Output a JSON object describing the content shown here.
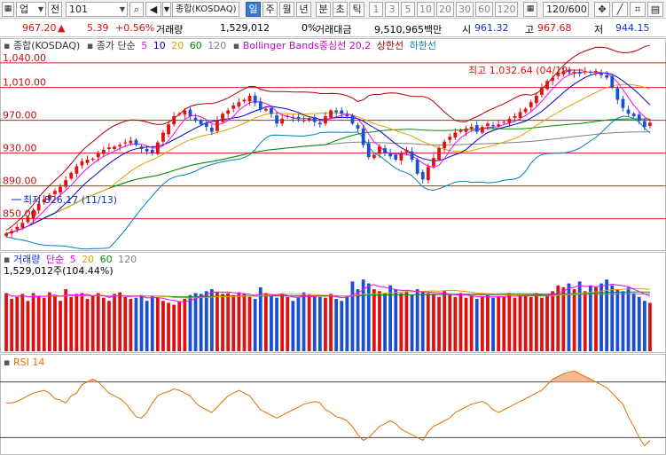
{
  "toolbar": {
    "market": "업",
    "market_btn": "전",
    "code": "101",
    "index_name": "종합(KOSDAQ)",
    "periods": [
      "일",
      "주",
      "월",
      "년",
      "분",
      "초",
      "틱"
    ],
    "selected_period": "일",
    "minute_steps": [
      "1",
      "3",
      "5",
      "10",
      "20",
      "30",
      "60",
      "120"
    ],
    "count_display": "120/600"
  },
  "quote": {
    "price": "967.20",
    "change_symbol": "▲",
    "change": "5.39",
    "change_pct": "+0.56%",
    "volume_label": "거래량",
    "volume": "1,529,012",
    "volume_ratio": "0%",
    "amount_label": "거래대금",
    "amount": "9,510,965백만",
    "open_label": "시",
    "open": "961.32",
    "high_label": "고",
    "high": "967.68",
    "low_label": "저",
    "low": "944.15"
  },
  "price_pane": {
    "legend_name": "종합(KOSDAQ)",
    "ma_label": "종가 단순",
    "ma_periods": [
      "5",
      "10",
      "20",
      "60",
      "120"
    ],
    "bollinger_label": "Bollinger Bands중심선 20,2",
    "upper_label": "상한선",
    "lower_label": "하한선",
    "y_ticks": [
      "1,040.00",
      "1,010.00",
      "970.00",
      "930.00",
      "890.00",
      "850.00"
    ],
    "high_annotation": "최고 1,032.64 (04/19)",
    "low_annotation": "최저 826.17 (11/13)"
  },
  "volume_pane": {
    "label": "거래량",
    "ma_label": "단순",
    "ma_periods": [
      "5",
      "20",
      "60",
      "120"
    ],
    "current": "1,529,012주(104.44%)"
  },
  "rsi_pane": {
    "label": "RSI 14"
  },
  "colors": {
    "up": "#e01010",
    "down": "#1a4fd0",
    "ma5": "#ff00ff",
    "ma10": "#0000cc",
    "ma20": "#e0a000",
    "ma60": "#009000",
    "ma120": "#808080",
    "bollinger_upper": "#b00000",
    "bollinger_mid": "#e07000",
    "bollinger_lower": "#0080c0",
    "rsi_line": "#e07000",
    "rsi_fill": "#f5b890"
  },
  "chart_data": {
    "type": "candlestick",
    "price_range": [
      815,
      1055
    ],
    "closes": [
      832,
      835,
      840,
      845,
      852,
      860,
      868,
      874,
      879,
      884,
      889,
      897,
      906,
      914,
      920,
      922,
      923,
      930,
      934,
      937,
      938,
      940,
      943,
      945,
      940,
      935,
      932,
      930,
      943,
      955,
      965,
      975,
      978,
      982,
      975,
      970,
      965,
      962,
      956,
      970,
      978,
      982,
      988,
      992,
      995,
      1000,
      991,
      983,
      984,
      978,
      966,
      972,
      975,
      973,
      972,
      970,
      972,
      968,
      965,
      975,
      982,
      980,
      978,
      975,
      966,
      960,
      940,
      925,
      928,
      938,
      930,
      926,
      922,
      930,
      934,
      922,
      905,
      898,
      913,
      924,
      936,
      944,
      950,
      955,
      958,
      960,
      962,
      956,
      962,
      966,
      963,
      965,
      968,
      972,
      975,
      980,
      984,
      992,
      1000,
      1010,
      1018,
      1022,
      1027,
      1030,
      1029,
      1029,
      1027,
      1030,
      1028,
      1030,
      1025,
      1022,
      1010,
      995,
      985,
      978,
      975,
      970,
      962,
      967
    ],
    "volume_max": 1900000,
    "volumes": [
      1500000,
      1350000,
      1400000,
      1480000,
      1300000,
      1500000,
      1420000,
      1380000,
      1520000,
      1450000,
      1300000,
      1600000,
      1400000,
      1480000,
      1500000,
      1350000,
      1420000,
      1500000,
      1380000,
      1300000,
      1480000,
      1520000,
      1400000,
      1350000,
      1380000,
      1450000,
      1300000,
      1420000,
      1380000,
      1300000,
      1250000,
      1200000,
      1280000,
      1350000,
      1450000,
      1500000,
      1480000,
      1550000,
      1600000,
      1520000,
      1480000,
      1500000,
      1450000,
      1520000,
      1480000,
      1400000,
      1350000,
      1650000,
      1500000,
      1420000,
      1380000,
      1480000,
      1400000,
      1300000,
      1380000,
      1520000,
      1450000,
      1420000,
      1400000,
      1380000,
      1480000,
      1350000,
      1300000,
      1420000,
      1800000,
      1600000,
      1850000,
      1750000,
      1600000,
      1550000,
      1500000,
      1700000,
      1600000,
      1500000,
      1550000,
      1450000,
      1600000,
      1550000,
      1500000,
      1480000,
      1400000,
      1550000,
      1450000,
      1400000,
      1500000,
      1380000,
      1420000,
      1350000,
      1400000,
      1450000,
      1380000,
      1420000,
      1400000,
      1500000,
      1380000,
      1450000,
      1420000,
      1400000,
      1500000,
      1380000,
      1450000,
      1550000,
      1700000,
      1650000,
      1750000,
      1600000,
      1800000,
      1550000,
      1700000,
      1650000,
      1750000,
      1850000,
      1700000,
      1600000,
      1550000,
      1650000,
      1500000,
      1400000,
      1300000,
      1250000
    ],
    "rsi": [
      55,
      55,
      56,
      58,
      60,
      62,
      63,
      64,
      62,
      58,
      57,
      55,
      60,
      62,
      68,
      70,
      72,
      70,
      66,
      62,
      60,
      58,
      55,
      50,
      45,
      44,
      48,
      55,
      60,
      62,
      63,
      65,
      64,
      62,
      60,
      55,
      52,
      50,
      48,
      52,
      56,
      60,
      62,
      64,
      62,
      60,
      55,
      50,
      48,
      46,
      44,
      46,
      48,
      50,
      52,
      54,
      55,
      56,
      55,
      50,
      48,
      45,
      44,
      42,
      38,
      32,
      28,
      30,
      34,
      38,
      40,
      42,
      40,
      36,
      34,
      32,
      30,
      28,
      34,
      38,
      40,
      42,
      44,
      48,
      50,
      52,
      54,
      55,
      56,
      54,
      50,
      48,
      50,
      52,
      54,
      56,
      58,
      60,
      62,
      64,
      68,
      72,
      74,
      76,
      77,
      78,
      76,
      74,
      72,
      70,
      68,
      66,
      62,
      58,
      54,
      45,
      38,
      30,
      24,
      28
    ],
    "rsi_range": [
      20,
      80
    ]
  }
}
